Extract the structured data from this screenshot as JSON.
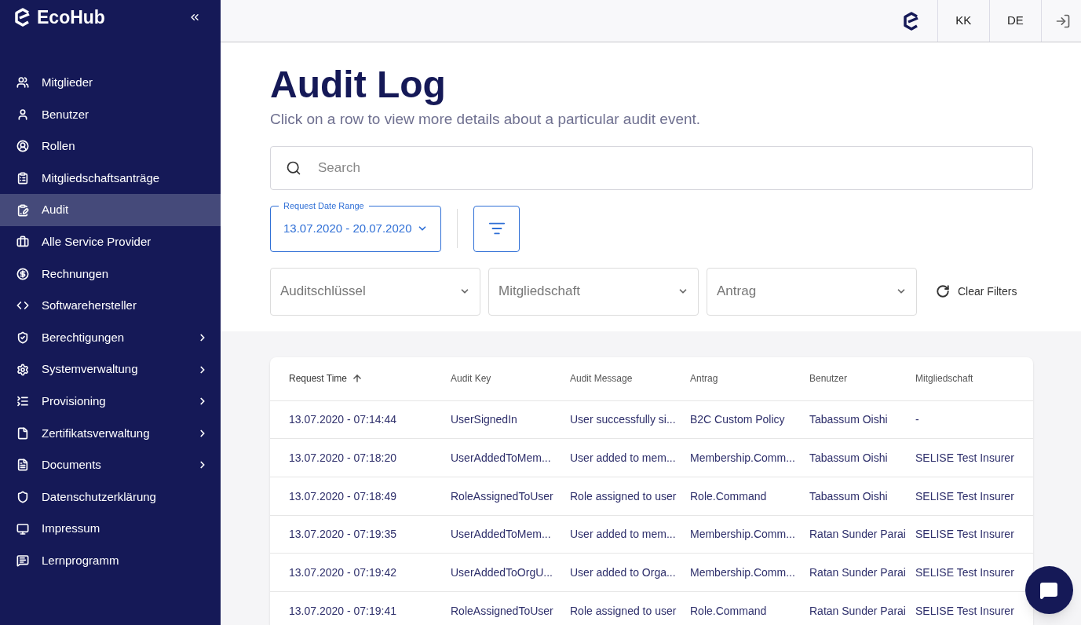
{
  "sidebar": {
    "brand": "EcoHub",
    "items": [
      {
        "label": "Mitglieder",
        "selected": false,
        "has_submenu": false
      },
      {
        "label": "Benutzer",
        "selected": false,
        "has_submenu": false
      },
      {
        "label": "Rollen",
        "selected": false,
        "has_submenu": false
      },
      {
        "label": "Mitgliedschaftsanträge",
        "selected": false,
        "has_submenu": false
      },
      {
        "label": "Audit",
        "selected": true,
        "has_submenu": false
      },
      {
        "label": "Alle Service Provider",
        "selected": false,
        "has_submenu": false
      },
      {
        "label": "Rechnungen",
        "selected": false,
        "has_submenu": false
      },
      {
        "label": "Softwarehersteller",
        "selected": false,
        "has_submenu": false
      },
      {
        "label": "Berechtigungen",
        "selected": false,
        "has_submenu": true
      },
      {
        "label": "Systemverwaltung",
        "selected": false,
        "has_submenu": true
      },
      {
        "label": "Provisioning",
        "selected": false,
        "has_submenu": true
      },
      {
        "label": "Zertifikatsverwaltung",
        "selected": false,
        "has_submenu": true
      },
      {
        "label": "Documents",
        "selected": false,
        "has_submenu": true
      },
      {
        "label": "Datenschutzerklärung",
        "selected": false,
        "has_submenu": false
      },
      {
        "label": "Impressum",
        "selected": false,
        "has_submenu": false
      },
      {
        "label": "Lernprogramm",
        "selected": false,
        "has_submenu": false
      }
    ]
  },
  "top_bar": {
    "buttons": [
      "KK",
      "DE"
    ]
  },
  "page": {
    "title": "Audit Log",
    "subtitle": "Click on a row to view more details about a particular audit event.",
    "search": {
      "placeholder": "Search"
    },
    "date_range": {
      "label": "Request Date Range",
      "value": "13.07.2020 - 20.07.2020"
    },
    "filters": [
      {
        "placeholder": "Auditschlüssel"
      },
      {
        "placeholder": "Mitgliedschaft"
      },
      {
        "placeholder": "Antrag"
      }
    ],
    "clear_filters": "Clear Filters"
  },
  "table": {
    "columns": [
      {
        "label": "Request Time",
        "sorted": true
      },
      {
        "label": "Audit Key",
        "sorted": false
      },
      {
        "label": "Audit Message",
        "sorted": false
      },
      {
        "label": "Antrag",
        "sorted": false
      },
      {
        "label": "Benutzer",
        "sorted": false
      },
      {
        "label": "Mitgliedschaft",
        "sorted": false
      }
    ],
    "rows": [
      [
        "13.07.2020 - 07:14:44",
        "UserSignedIn",
        "User successfully si...",
        "B2C Custom Policy",
        "Tabassum Oishi",
        "-"
      ],
      [
        "13.07.2020 - 07:18:20",
        "UserAddedToMem...",
        "User added to mem...",
        "Membership.Comm...",
        "Tabassum Oishi",
        "SELISE Test Insurer"
      ],
      [
        "13.07.2020 - 07:18:49",
        "RoleAssignedToUser",
        "Role assigned to user",
        "Role.Command",
        "Tabassum Oishi",
        "SELISE Test Insurer"
      ],
      [
        "13.07.2020 - 07:19:35",
        "UserAddedToMem...",
        "User added to mem...",
        "Membership.Comm...",
        "Ratan Sunder Parai",
        "SELISE Test Insurer"
      ],
      [
        "13.07.2020 - 07:19:42",
        "UserAddedToOrgU...",
        "User added to Orga...",
        "Membership.Comm...",
        "Ratan Sunder Parai",
        "SELISE Test Insurer"
      ],
      [
        "13.07.2020 - 07:19:41",
        "RoleAssignedToUser",
        "Role assigned to user",
        "Role.Command",
        "Ratan Sunder Parai",
        "SELISE Test Insurer"
      ]
    ]
  }
}
